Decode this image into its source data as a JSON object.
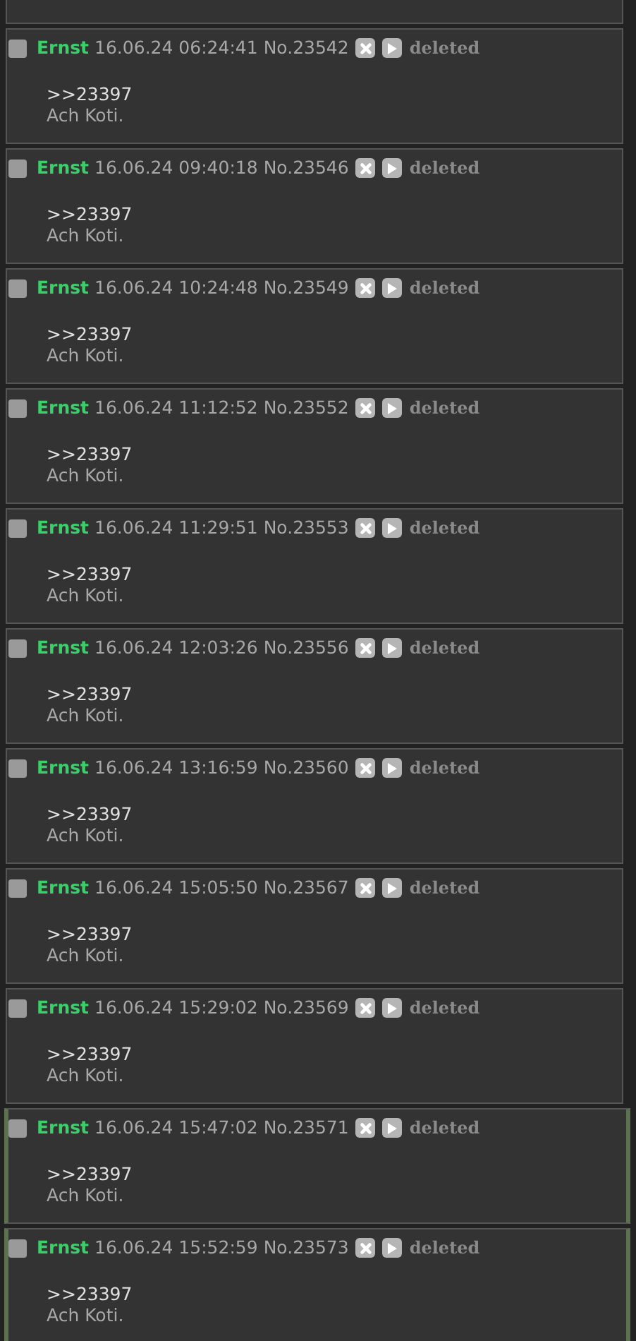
{
  "posts": [
    {
      "name": "Ernst",
      "date": "16.06.24 06:24:41",
      "number": "No.23542",
      "status": "deleted",
      "reply_link": ">>23397",
      "text": "Ach Koti.",
      "checked": false,
      "highlighted": false
    },
    {
      "name": "Ernst",
      "date": "16.06.24 09:40:18",
      "number": "No.23546",
      "status": "deleted",
      "reply_link": ">>23397",
      "text": "Ach Koti.",
      "checked": false,
      "highlighted": false
    },
    {
      "name": "Ernst",
      "date": "16.06.24 10:24:48",
      "number": "No.23549",
      "status": "deleted",
      "reply_link": ">>23397",
      "text": "Ach Koti.",
      "checked": false,
      "highlighted": false
    },
    {
      "name": "Ernst",
      "date": "16.06.24 11:12:52",
      "number": "No.23552",
      "status": "deleted",
      "reply_link": ">>23397",
      "text": "Ach Koti.",
      "checked": false,
      "highlighted": false
    },
    {
      "name": "Ernst",
      "date": "16.06.24 11:29:51",
      "number": "No.23553",
      "status": "deleted",
      "reply_link": ">>23397",
      "text": "Ach Koti.",
      "checked": false,
      "highlighted": false
    },
    {
      "name": "Ernst",
      "date": "16.06.24 12:03:26",
      "number": "No.23556",
      "status": "deleted",
      "reply_link": ">>23397",
      "text": "Ach Koti.",
      "checked": false,
      "highlighted": false
    },
    {
      "name": "Ernst",
      "date": "16.06.24 13:16:59",
      "number": "No.23560",
      "status": "deleted",
      "reply_link": ">>23397",
      "text": "Ach Koti.",
      "checked": false,
      "highlighted": false
    },
    {
      "name": "Ernst",
      "date": "16.06.24 15:05:50",
      "number": "No.23567",
      "status": "deleted",
      "reply_link": ">>23397",
      "text": "Ach Koti.",
      "checked": false,
      "highlighted": false
    },
    {
      "name": "Ernst",
      "date": "16.06.24 15:29:02",
      "number": "No.23569",
      "status": "deleted",
      "reply_link": ">>23397",
      "text": "Ach Koti.",
      "checked": false,
      "highlighted": false
    },
    {
      "name": "Ernst",
      "date": "16.06.24 15:47:02",
      "number": "No.23571",
      "status": "deleted",
      "reply_link": ">>23397",
      "text": "Ach Koti.",
      "checked": false,
      "highlighted": true
    },
    {
      "name": "Ernst",
      "date": "16.06.24 15:52:59",
      "number": "No.23573",
      "status": "deleted",
      "reply_link": ">>23397",
      "text": "Ach Koti.",
      "checked": false,
      "highlighted": true
    }
  ]
}
